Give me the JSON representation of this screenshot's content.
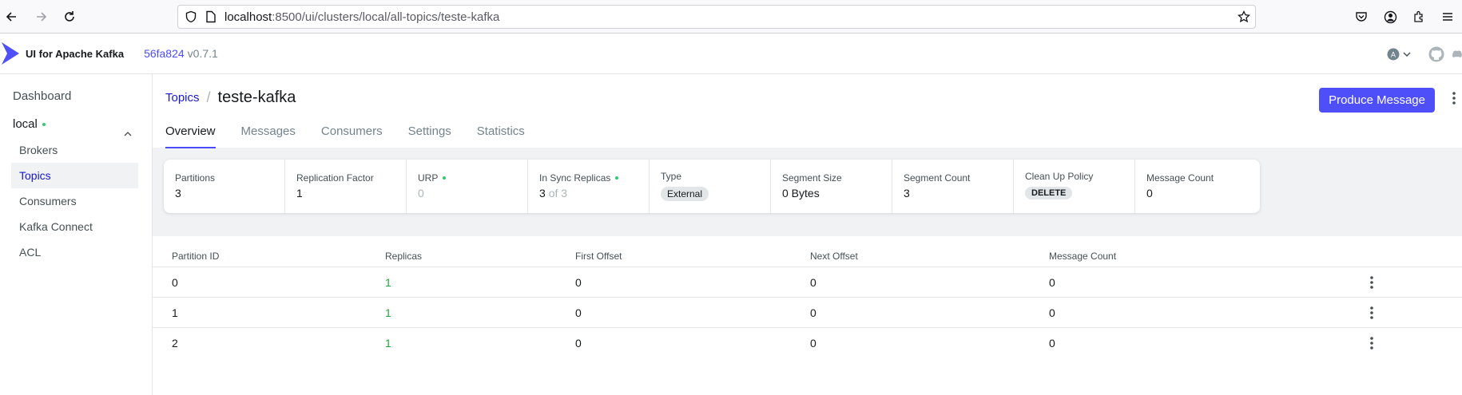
{
  "browser": {
    "url_host": "localhost",
    "url_path": ":8500/ui/clusters/local/all-topics/teste-kafka"
  },
  "header": {
    "app_name": "UI for Apache Kafka",
    "commit": "56fa824",
    "version": "v0.7.1"
  },
  "sidebar": {
    "dashboard": "Dashboard",
    "cluster": "local",
    "items": [
      "Brokers",
      "Topics",
      "Consumers",
      "Kafka Connect",
      "ACL"
    ],
    "active_item": "Topics"
  },
  "page": {
    "breadcrumb": "Topics",
    "separator": "/",
    "title": "teste-kafka",
    "produce_button": "Produce Message"
  },
  "tabs": [
    "Overview",
    "Messages",
    "Consumers",
    "Settings",
    "Statistics"
  ],
  "active_tab": "Overview",
  "metrics": {
    "partitions": {
      "label": "Partitions",
      "value": "3"
    },
    "replication_factor": {
      "label": "Replication Factor",
      "value": "1"
    },
    "urp": {
      "label": "URP",
      "value": "0"
    },
    "in_sync": {
      "label": "In Sync Replicas",
      "value": "3",
      "of": "of 3"
    },
    "type": {
      "label": "Type",
      "value": "External"
    },
    "segment_size": {
      "label": "Segment Size",
      "value": "0 Bytes"
    },
    "segment_count": {
      "label": "Segment Count",
      "value": "3"
    },
    "cleanup_policy": {
      "label": "Clean Up Policy",
      "value": "DELETE"
    },
    "message_count": {
      "label": "Message Count",
      "value": "0"
    }
  },
  "table": {
    "headers": [
      "Partition ID",
      "Replicas",
      "First Offset",
      "Next Offset",
      "Message Count"
    ],
    "rows": [
      [
        "0",
        "1",
        "0",
        "0",
        "0"
      ],
      [
        "1",
        "1",
        "0",
        "0",
        "0"
      ],
      [
        "2",
        "1",
        "0",
        "0",
        "0"
      ]
    ]
  },
  "colors": {
    "accent": "#4f4ffa",
    "link": "#1717cf",
    "green": "#1fa63a"
  }
}
